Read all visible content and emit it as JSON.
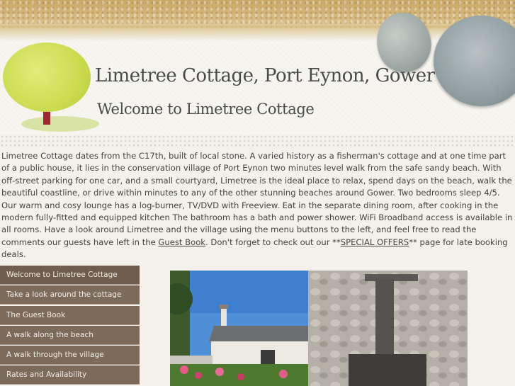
{
  "header": {
    "site_title": "Limetree Cottage, Port Eynon, Gower",
    "subtitle": "Welcome to Limetree Cottage"
  },
  "intro": {
    "text_part1": "Limetree Cottage dates from the C17th, built of local stone. A varied history as a fisherman's cottage and at one time part of a public house, it lies in the conservation village of Port Eynon two minutes level walk from the safe sandy beach. With off-street parking for one car, and a small courtyard, Limetree is the ideal place to relax, spend days on the beach, walk the beautiful coastline, or drive within minutes to any of the other stunning beaches around Gower. Two bedrooms sleep 4/5. Our warm and cosy lounge has a log-burner, TV/DVD with Freeview. Eat in the separate dining room, after cooking in the modern fully-fitted and equipped kitchen The bathroom has a bath and power shower. WiFi Broadband access is available in all rooms. Have a look around Limetree and the village using the menu buttons to the left, and feel free to read the comments our guests have left in the ",
    "guest_book_link": "Guest Book",
    "text_part2": ". Don't forget to check out our **",
    "special_offers_link": "SPECIAL OFFERS",
    "text_part3": "** page for late booking deals."
  },
  "nav": {
    "items": [
      "Welcome to Limetree Cottage",
      "Take a look around the cottage",
      "The Guest Book",
      "A walk along the beach",
      "A walk through the village",
      "Rates and Availability"
    ]
  },
  "colors": {
    "nav_bg": "#7d6b5a",
    "tree_green": "#c7d94a",
    "trunk_red": "#a0282e"
  }
}
